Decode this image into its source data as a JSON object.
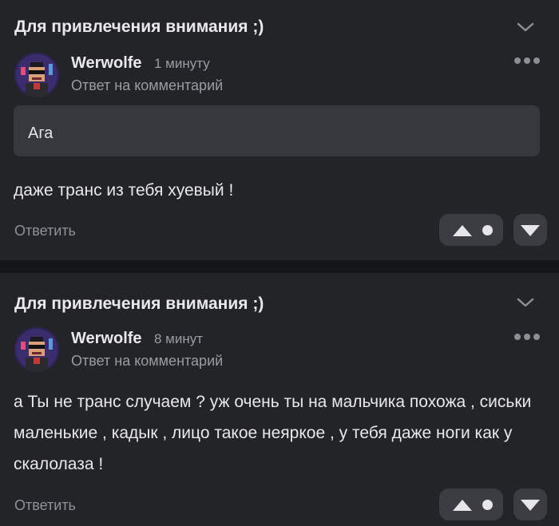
{
  "comments": [
    {
      "title": "Для привлечения внимания ;)",
      "author": "Werwolfe",
      "time": "1 минуту",
      "reply_label": "Ответ на комментарий",
      "quote": "Ага",
      "text": "даже транс из тебя хуевый !",
      "reply_button": "Ответить"
    },
    {
      "title": "Для привлечения внимания ;)",
      "author": "Werwolfe",
      "time": "8 минут",
      "reply_label": "Ответ на комментарий",
      "text": "а Ты не транс случаем ? уж очень ты на мальчика похожа , сиськи маленькие , кадык , лицо такое неяркое , у тебя даже ноги как у скалолаза !",
      "reply_button": "Ответить"
    }
  ],
  "icons": {
    "collapse": "chevron-down-icon",
    "more": "more-dots-icon",
    "upvote": "triangle-up-icon",
    "downvote": "triangle-down-icon"
  },
  "colors": {
    "background": "#222428",
    "quote_background": "#36383d",
    "button_background": "#3b3d42",
    "muted_text": "#9a9ca3"
  }
}
